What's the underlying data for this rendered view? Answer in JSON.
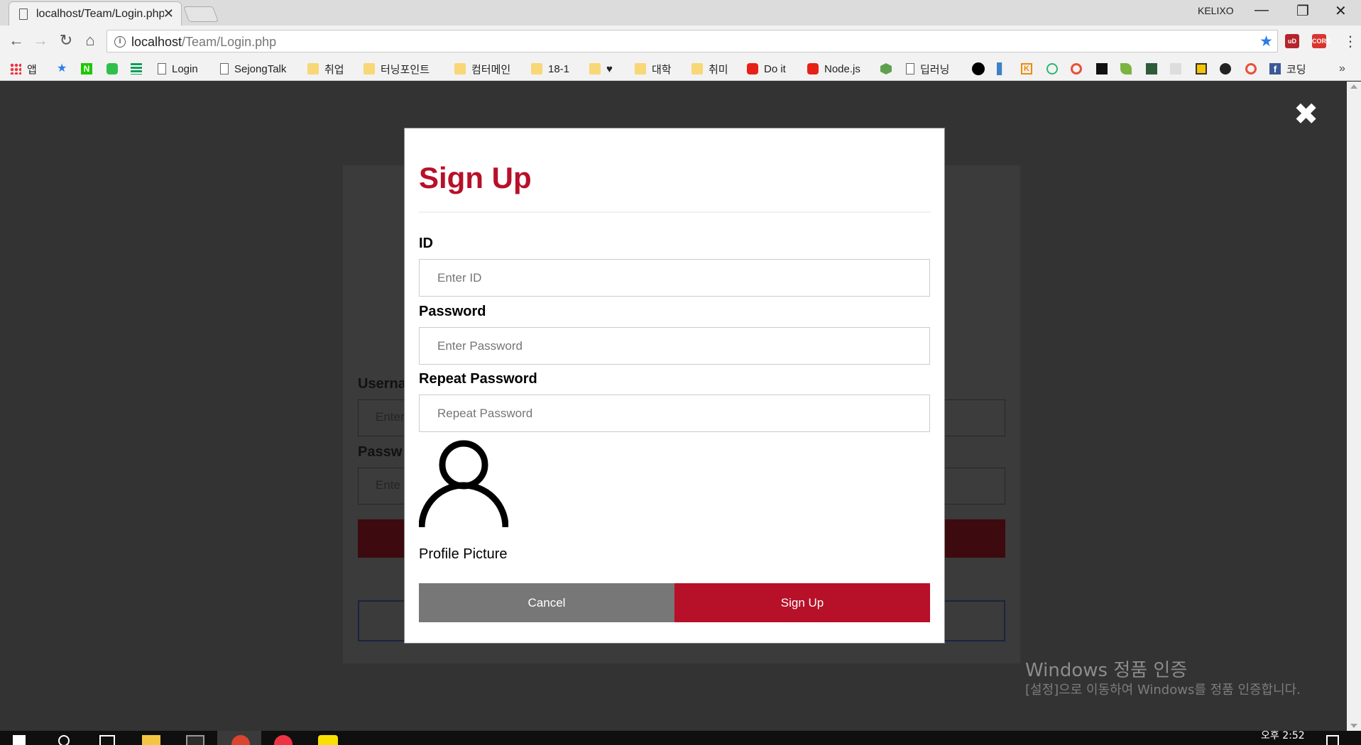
{
  "browser": {
    "tab_title": "localhost/Team/Login.php",
    "tab_close": "✕",
    "profile": "KELIXO",
    "url_host": "localhost",
    "url_path": "/Team/Login.php",
    "bookmarks": [
      {
        "label": "앱",
        "icon": "apps-grid-icon"
      },
      {
        "label": "",
        "icon": "star-icon"
      },
      {
        "label": "",
        "icon": "naver-icon"
      },
      {
        "label": "",
        "icon": "line-icon"
      },
      {
        "label": "",
        "icon": "sheets-icon"
      },
      {
        "label": "Login",
        "icon": "page-icon"
      },
      {
        "label": "SejongTalk",
        "icon": "page-icon"
      },
      {
        "label": "취업",
        "icon": "folder-icon"
      },
      {
        "label": "터닝포인트",
        "icon": "folder-icon"
      },
      {
        "label": "컴터메인",
        "icon": "folder-icon"
      },
      {
        "label": "18-1",
        "icon": "folder-icon"
      },
      {
        "label": "♥",
        "icon": "folder-icon"
      },
      {
        "label": "대학",
        "icon": "folder-icon"
      },
      {
        "label": "취미",
        "icon": "folder-icon"
      },
      {
        "label": "Do it",
        "icon": "youtube-icon"
      },
      {
        "label": "Node.js",
        "icon": "youtube-icon"
      },
      {
        "label": "딥러닝",
        "icon": "page-icon"
      },
      {
        "label": "코딩",
        "icon": "facebook-icon"
      }
    ],
    "extensions": [
      "uD",
      "CORS"
    ],
    "more": "»"
  },
  "background_form": {
    "username_label": "Userna",
    "username_placeholder": "Enter",
    "password_label": "Passw",
    "password_placeholder": "Ente"
  },
  "overlay": {
    "close": "✖"
  },
  "modal": {
    "title": "Sign Up",
    "fields": [
      {
        "label": "ID",
        "placeholder": "Enter ID"
      },
      {
        "label": "Password",
        "placeholder": "Enter Password"
      },
      {
        "label": "Repeat Password",
        "placeholder": "Repeat Password"
      }
    ],
    "profile_caption": "Profile Picture",
    "cancel_label": "Cancel",
    "signup_label": "Sign Up",
    "colors": {
      "accent": "#b71029",
      "cancel": "#777777"
    }
  },
  "watermark": {
    "title": "Windows 정품 인증",
    "subtitle": "[설정]으로 이동하여 Windows를 정품 인증합니다."
  },
  "taskbar": {
    "clock": "오후 2:52"
  }
}
